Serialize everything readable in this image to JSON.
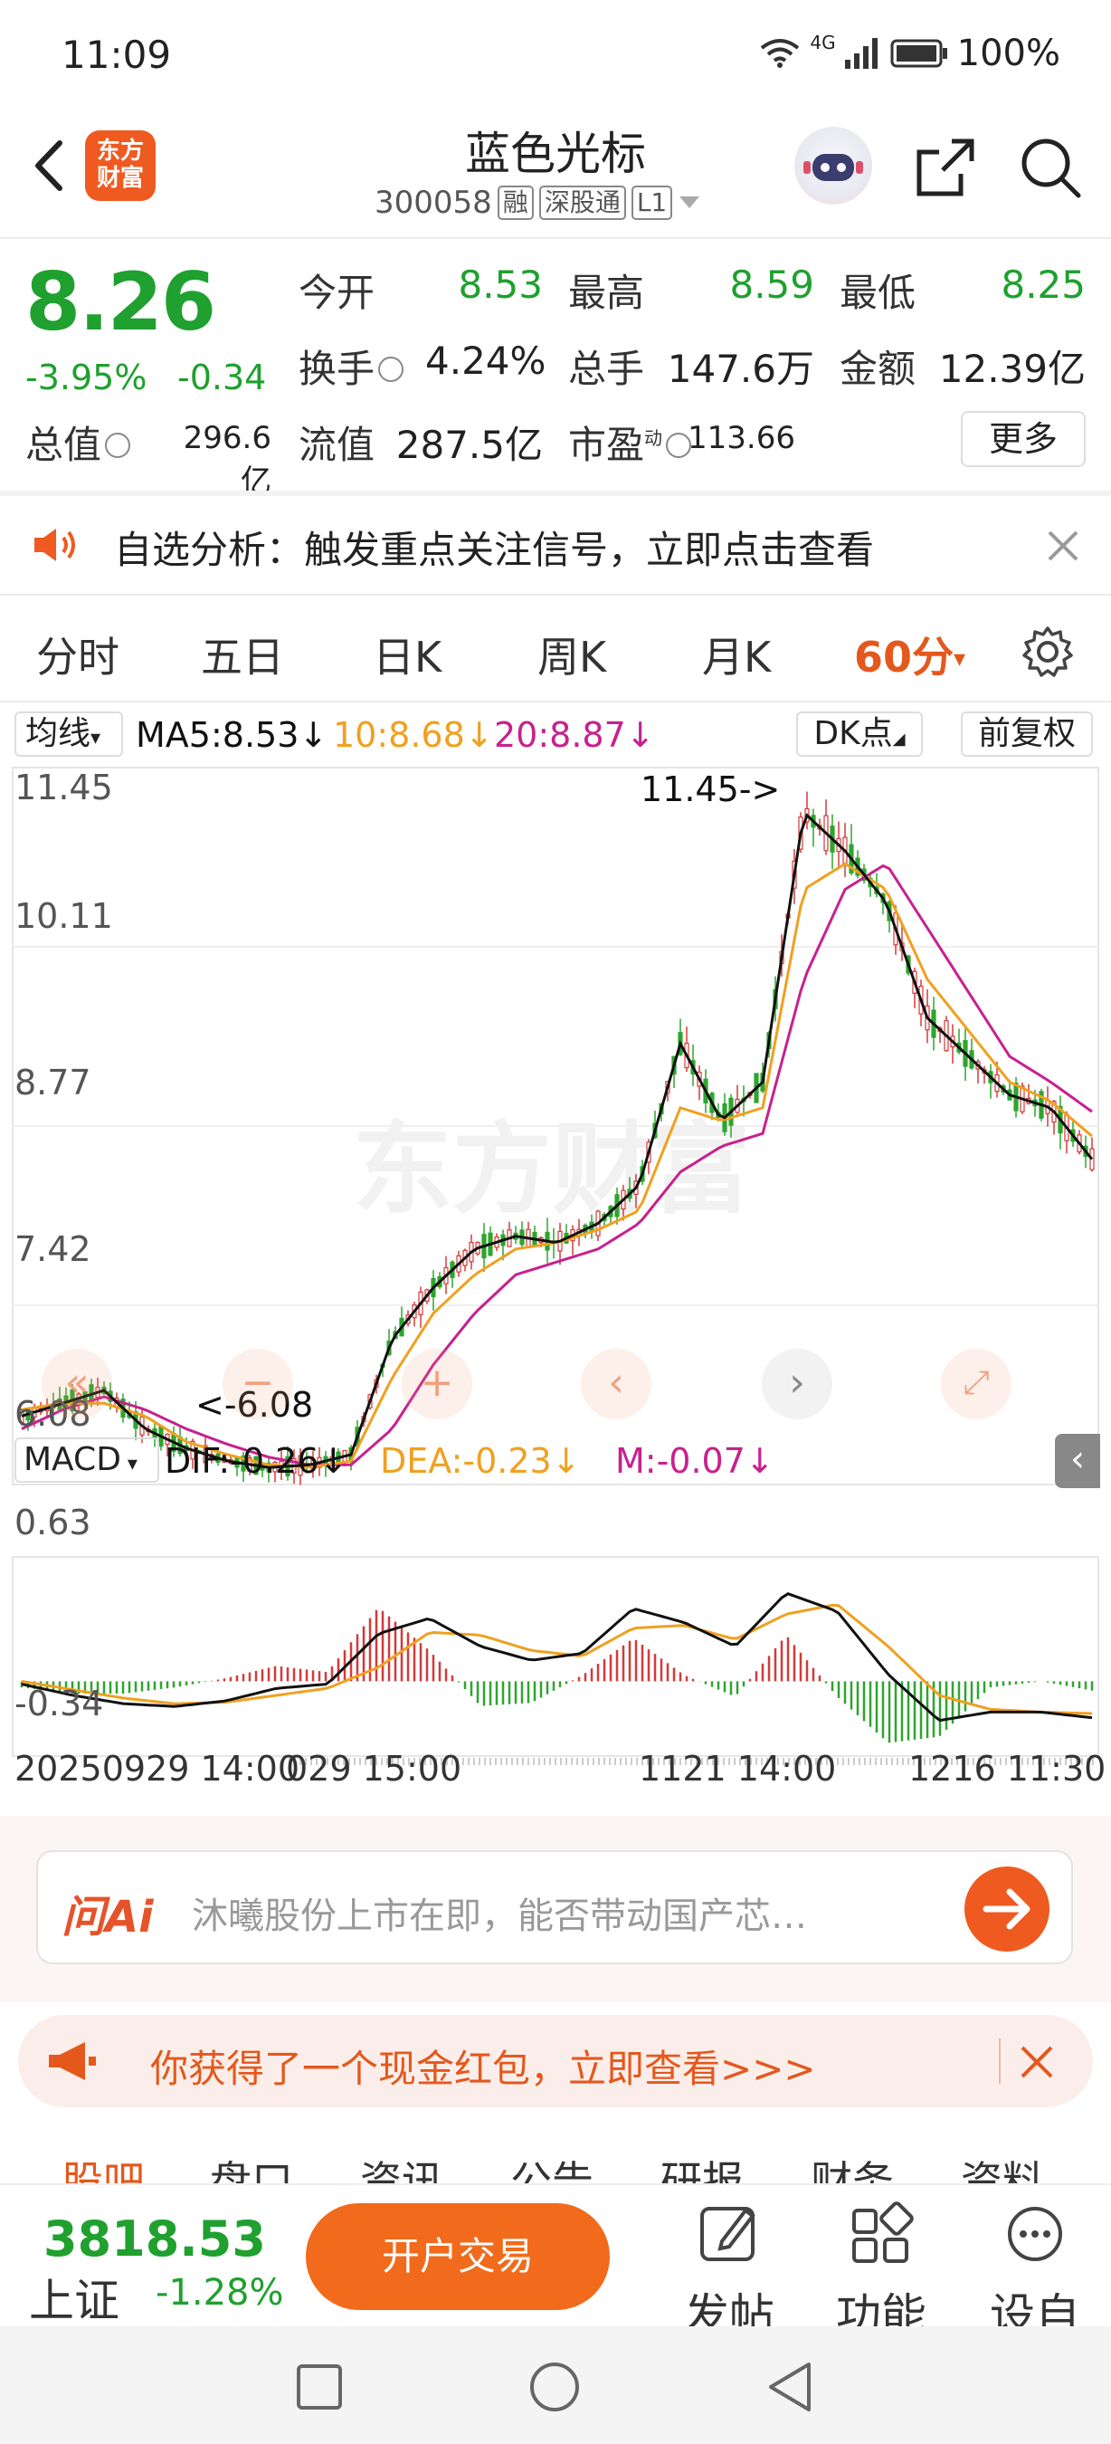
{
  "status": {
    "time": "11:09",
    "network": "4G",
    "battery": "100%"
  },
  "header": {
    "name": "蓝色光标",
    "code": "300058",
    "tags": [
      "融",
      "深股通",
      "L1"
    ],
    "logo_lines": [
      "东方",
      "财富"
    ]
  },
  "quote": {
    "price": "8.26",
    "pct": "-3.95%",
    "change": "-0.34",
    "rows": [
      [
        {
          "label": "今开",
          "value": "8.53",
          "green": true
        },
        {
          "label": "最高",
          "value": "8.59",
          "green": true
        },
        {
          "label": "最低",
          "value": "8.25",
          "green": true
        }
      ],
      [
        {
          "label": "换手",
          "value": "4.24%"
        },
        {
          "label": "总手",
          "value": "147.6万"
        },
        {
          "label": "金额",
          "value": "12.39亿"
        }
      ],
      [
        {
          "label": "总值",
          "value": "296.6亿"
        },
        {
          "label": "流值",
          "value": "287.5亿"
        },
        {
          "label": "市盈",
          "sup": "动",
          "value": "113.66"
        }
      ]
    ],
    "more_label": "更多"
  },
  "notice": {
    "text": "自选分析：触发重点关注信号，立即点击查看"
  },
  "tabs": [
    {
      "label": "分时"
    },
    {
      "label": "五日"
    },
    {
      "label": "日K"
    },
    {
      "label": "周K"
    },
    {
      "label": "月K"
    },
    {
      "label": "60分",
      "active": true
    }
  ],
  "chart": {
    "ma_menu": "均线",
    "ma5": "MA5:8.53↓",
    "ma10": "10:8.68↓",
    "ma20": "20:8.87↓",
    "dk_label": "DK点",
    "adjust_label": "前复权",
    "y_ticks": [
      "11.45",
      "10.11",
      "8.77",
      "7.42",
      "6.08"
    ],
    "max_label": "11.45->",
    "min_label": "<-6.08",
    "watermark": "东方财富",
    "macd_menu": "MACD",
    "dif": "DIF:-0.26↓",
    "dea": "DEA:-0.23↓",
    "m": "M:-0.07↓",
    "macd_ticks": [
      "0.63",
      "-0.34"
    ],
    "x_labels": [
      "20250929 14:00",
      "029 15:00",
      "1121 14:00",
      "1216 11:30"
    ],
    "colors": {
      "up": "#d33a3a",
      "down": "#2ea52e",
      "ma5": "#111111",
      "ma10": "#f0a020",
      "ma20": "#c8208e"
    }
  },
  "chart_data": {
    "type": "candlestick",
    "price_range": [
      6.08,
      11.45
    ],
    "macd_range": [
      -0.34,
      0.63
    ],
    "x_labels": [
      "20250929 14:00",
      "029 15:00",
      "1121 14:00",
      "1216 11:30"
    ],
    "ma5_approx": [
      6.5,
      6.6,
      6.7,
      6.4,
      6.25,
      6.15,
      6.1,
      6.12,
      6.2,
      7.1,
      7.5,
      7.8,
      7.9,
      7.85,
      8.0,
      8.3,
      9.4,
      8.8,
      9.1,
      11.2,
      10.9,
      10.5,
      9.6,
      9.3,
      9.0,
      8.9,
      8.5
    ],
    "ma10_approx": [
      6.55,
      6.6,
      6.6,
      6.5,
      6.3,
      6.2,
      6.12,
      6.1,
      6.15,
      6.8,
      7.3,
      7.6,
      7.8,
      7.85,
      7.95,
      8.1,
      8.9,
      8.8,
      8.9,
      10.6,
      10.8,
      10.6,
      9.9,
      9.5,
      9.1,
      8.95,
      8.68
    ],
    "ma20_approx": [
      6.4,
      6.55,
      6.65,
      6.55,
      6.4,
      6.28,
      6.18,
      6.12,
      6.12,
      6.4,
      6.9,
      7.3,
      7.6,
      7.7,
      7.8,
      8.0,
      8.4,
      8.6,
      8.7,
      9.9,
      10.6,
      10.8,
      10.3,
      9.8,
      9.3,
      9.1,
      8.87
    ],
    "dif_approx": [
      -0.02,
      -0.1,
      -0.16,
      -0.18,
      -0.14,
      -0.05,
      -0.02,
      0.34,
      0.45,
      0.25,
      0.15,
      0.2,
      0.52,
      0.42,
      0.25,
      0.63,
      0.5,
      0.05,
      -0.28,
      -0.22,
      -0.22,
      -0.26
    ],
    "dea_approx": [
      0.0,
      -0.06,
      -0.12,
      -0.16,
      -0.15,
      -0.1,
      -0.05,
      0.1,
      0.35,
      0.33,
      0.22,
      0.18,
      0.38,
      0.4,
      0.3,
      0.48,
      0.55,
      0.25,
      -0.1,
      -0.2,
      -0.22,
      -0.23
    ]
  },
  "ai": {
    "brand": "问Ai",
    "placeholder": "沐曦股份上市在即，能否带动国产芯…"
  },
  "packet": {
    "text": "你获得了一个现金红包，立即查看>>>"
  },
  "peek_tabs": [
    "股吧",
    "盘口",
    "资讯",
    "公告",
    "研报",
    "财务",
    "资料"
  ],
  "bottom": {
    "index_value": "3818.53",
    "index_name": "上证",
    "index_pct": "-1.28%",
    "trade_label": "开户交易",
    "post_label": "发帖",
    "func_label": "功能",
    "watch_label": "设自选"
  }
}
